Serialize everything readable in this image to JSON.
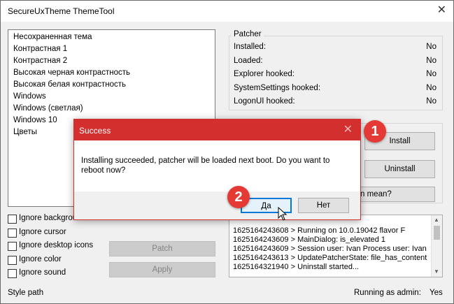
{
  "window": {
    "title": "SecureUxTheme ThemeTool",
    "close_glyph": "✕"
  },
  "themes": [
    "Несохраненная тема",
    "Контрастная 1",
    "Контрастная 2",
    "Высокая черная контрастность",
    "Высокая белая контрастность",
    "Windows",
    "Windows (светлая)",
    "Windows 10",
    "Цветы"
  ],
  "patcher": {
    "label": "Patcher",
    "rows": [
      {
        "key": "Installed:",
        "value": "No"
      },
      {
        "key": "Loaded:",
        "value": "No"
      },
      {
        "key": "Explorer hooked:",
        "value": "No"
      },
      {
        "key": "SystemSettings hooked:",
        "value": "No"
      },
      {
        "key": "LogonUI hooked:",
        "value": "No"
      }
    ]
  },
  "buttons": {
    "install": "Install",
    "uninstall": "Uninstall",
    "what_mean": "n mean?",
    "patch": "Patch",
    "apply": "Apply"
  },
  "checkboxes": [
    "Ignore backgrou",
    "Ignore cursor",
    "Ignore desktop icons",
    "Ignore color",
    "Ignore sound"
  ],
  "log": {
    "lines": [
      "1625164243608 > Running on 10.0.19042 flavor F",
      "1625164243609 > MainDialog: is_elevated 1",
      "1625164243609 > Session user: Ivan Process user: Ivan",
      "1625164243613 > UpdatePatcherState: file_has_content",
      "1625164321940 > Uninstall started..."
    ]
  },
  "status": {
    "style_path": "Style path",
    "admin_label": "Running as admin:",
    "admin_value": "Yes"
  },
  "dialog": {
    "title": "Success",
    "close_glyph": "✕",
    "message": "Installing succeeded, patcher will be loaded next boot. Do you want to reboot now?",
    "yes": "Да",
    "no": "Нет"
  },
  "annotations": {
    "badge1": "1",
    "badge2": "2"
  },
  "colors": {
    "dialog_title_bg": "#d32f2f",
    "focus_border": "#0078d7",
    "badge_bg": "#e53935"
  },
  "icons": {
    "cursor": "mouse-pointer-icon"
  }
}
